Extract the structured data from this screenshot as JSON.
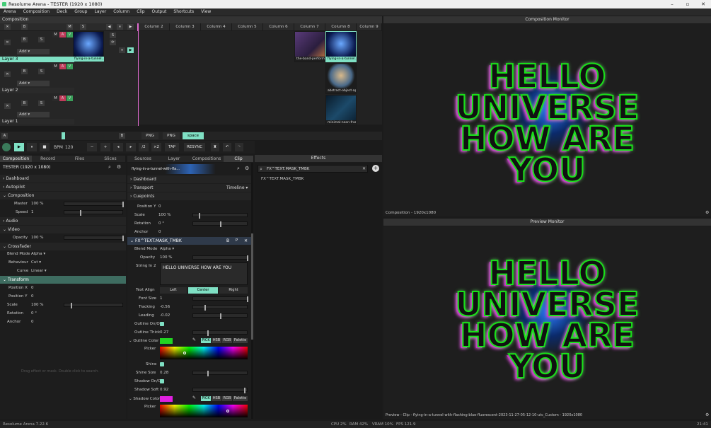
{
  "window": {
    "title": "Resolume Arena - TESTER (1920 x 1080)"
  },
  "menu": [
    "Arena",
    "Composition",
    "Deck",
    "Group",
    "Layer",
    "Column",
    "Clip",
    "Output",
    "Shortcuts",
    "View"
  ],
  "composition_panel": {
    "title": "Composition"
  },
  "columns": [
    "Column 2",
    "Column 3",
    "Column 4",
    "Column 5",
    "Column 6",
    "Column 7",
    "Column 8",
    "Column 9"
  ],
  "layers": [
    {
      "name": "Layer 3",
      "add_label": "Add",
      "clips": [
        {
          "name": "flying-in-a-tunnel..."
        },
        {
          "name": "the-band-perform..."
        },
        {
          "name": "flying-in-a-tunnel..."
        }
      ]
    },
    {
      "name": "Layer 2",
      "add_label": "Add",
      "clips": [
        {
          "name": "abstract-object-ap..."
        }
      ]
    },
    {
      "name": "Layer 1",
      "add_label": "Add",
      "clips": [
        {
          "name": "minimal-neon-frame..."
        }
      ]
    }
  ],
  "layer_buttons": {
    "b": "B",
    "s": "S",
    "m": "M",
    "a": "A",
    "v": "V",
    "x": "✕"
  },
  "deck_tabs": [
    "PNG",
    "PNG",
    "space"
  ],
  "transport": {
    "bpm_label": "BPM",
    "bpm_value": "120",
    "minus": "−",
    "plus": "+",
    "div": "/2",
    "mul": "×2",
    "tap": "TAP",
    "resync": "RESYNC"
  },
  "left_tabs": [
    "Composition",
    "Record",
    "Files",
    "Slices"
  ],
  "left_panel": {
    "title": "TESTER (1920 x 1080)",
    "sections": [
      "Dashboard",
      "Autopilot",
      "Composition",
      "Audio",
      "Video",
      "CrossFader",
      "Transform"
    ],
    "master_label": "Master",
    "master_value": "100 %",
    "speed_label": "Speed",
    "speed_value": "1",
    "opacity_label": "Opacity",
    "opacity_value": "100 %",
    "blend_label": "Blend Mode",
    "blend_value": "Alpha",
    "behaviour_label": "Behaviour",
    "behaviour_value": "Cut",
    "curve_label": "Curve",
    "curve_value": "Linear",
    "posx_label": "Position X",
    "posx_value": "0",
    "posy_label": "Position Y",
    "posy_value": "0",
    "scale_label": "Scale",
    "scale_value": "100 %",
    "rotation_label": "Rotation",
    "rotation_value": "0 °",
    "anchor_label": "Anchor",
    "anchor_value": "0",
    "drop_hint": "Drag effect or mask. Double click to search."
  },
  "mid_tabs": [
    "Sources",
    "Layer",
    "Compositions",
    "Clip"
  ],
  "clip_panel": {
    "clip_title": "flying-in-a-tunnel-with-fla...",
    "sections": [
      "Dashboard",
      "Transport",
      "Cuepoints"
    ],
    "transport_mode": "Timeline",
    "posy_label": "Position Y",
    "posy_value": "0",
    "scale_label": "Scale",
    "scale_value": "100 %",
    "rotation_label": "Rotation",
    "rotation_value": "0 °",
    "anchor_label": "Anchor",
    "anchor_value": "0",
    "effect_name": "FX^TEXT.MASK_TMBK",
    "blend_label": "Blend Mode",
    "blend_value": "Alpha",
    "opacity_label": "Opacity",
    "opacity_value": "100 %",
    "string_label": "String In 2",
    "string_value": "HELLO UNIVERSE HOW ARE YOU",
    "align_label": "Text Align",
    "align_options": [
      "Left",
      "Center",
      "Right"
    ],
    "fontsize_label": "Font Size",
    "fontsize_value": "1",
    "tracking_label": "Tracking",
    "tracking_value": "-0.56",
    "leading_label": "Leading",
    "leading_value": "-0.02",
    "outline_onoff_label": "Outline On/Off",
    "outline_thick_label": "Outline Thick",
    "outline_thick_value": "0.27",
    "outline_color_label": "Outline Color",
    "outline_color": "#22d422",
    "color_modes": [
      "PICK",
      "HSB",
      "RGB",
      "Palette"
    ],
    "picker_label": "Picker",
    "shine_label": "Shine",
    "shine_size_label": "Shine Size",
    "shine_size_value": "0.28",
    "shadow_onoff_label": "Shadow On/Off",
    "shadow_soft_label": "Shadow Soft",
    "shadow_soft_value": "0.92",
    "shadow_color_label": "Shadow Color",
    "shadow_color": "#e020e0"
  },
  "effects_panel": {
    "title": "Effects",
    "search_value": "FX^TEXT.MASK_TMBK",
    "result": "FX^TEXT.MASK_TMBK"
  },
  "composition_monitor": {
    "title": "Composition Monitor",
    "lines": [
      "HELLO",
      "UNIVERSE",
      "HOW ARE",
      "YOU"
    ],
    "footer": "Composition - 1920x1080"
  },
  "preview_monitor": {
    "title": "Preview Monitor",
    "lines": [
      "HELLO",
      "UNIVERSE",
      "HOW ARE",
      "YOU"
    ],
    "footer": "Preview - Clip - flying-in-a-tunnel-with-flashing-blue-fluorescent-2023-11-27-05-12-10-utc_Custom - 1920x1080"
  },
  "status": {
    "app": "Resolume Arena 7.22.6",
    "cpu": "CPU 2%",
    "ram": "RAM 42%",
    "vram": "VRAM 10%",
    "fps": "FPS 121.9",
    "time": "21:41"
  },
  "colors": {
    "accent": "#7fe0c4",
    "outline": "#22d422",
    "shadow": "#e020e0"
  }
}
